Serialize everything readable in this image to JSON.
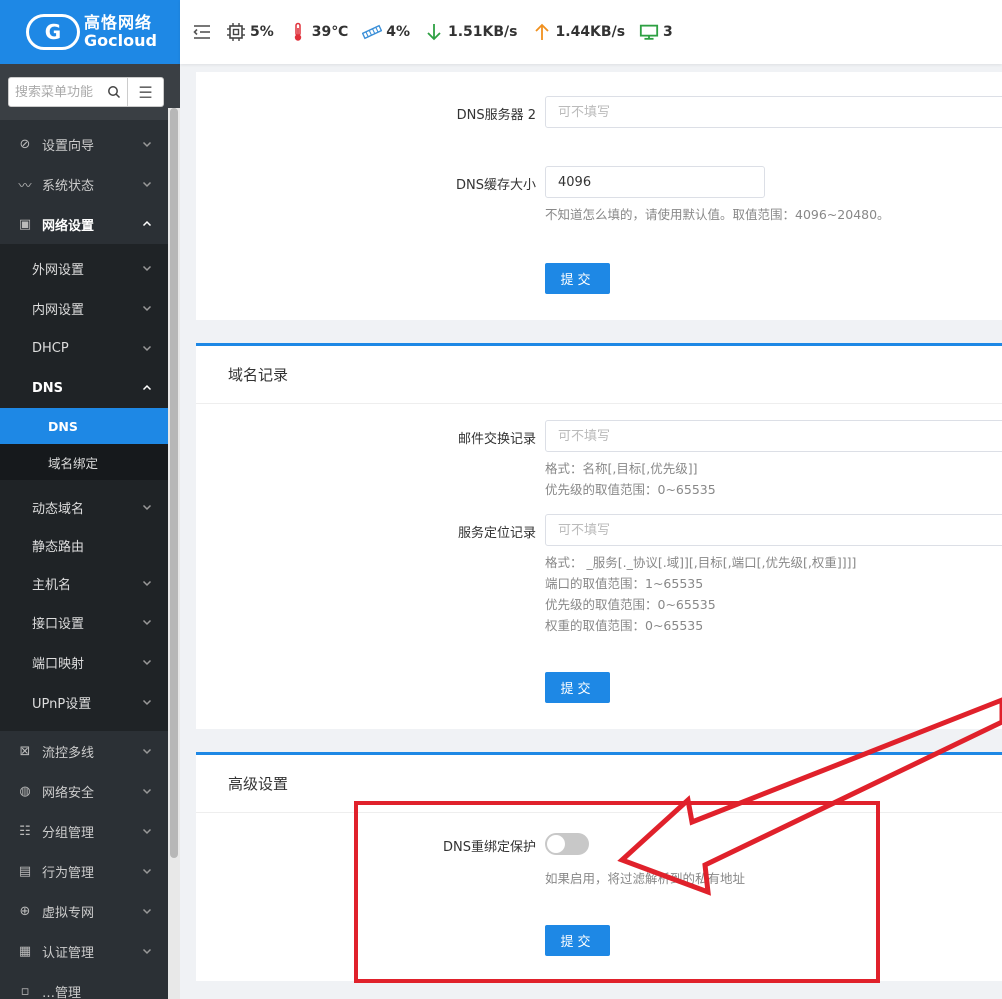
{
  "brand": {
    "cn": "高恪网络",
    "en": "Gocloud",
    "registered": "®"
  },
  "sidebar": {
    "search_placeholder": "搜索菜单功能",
    "items": [
      {
        "label": "设置向导"
      },
      {
        "label": "系统状态"
      },
      {
        "label": "网络设置"
      }
    ],
    "network_sub": [
      {
        "label": "外网设置"
      },
      {
        "label": "内网设置"
      },
      {
        "label": "DHCP"
      },
      {
        "label": "DNS"
      }
    ],
    "dns_sub": [
      {
        "label": "DNS"
      },
      {
        "label": "域名绑定"
      }
    ],
    "network_sub_after": [
      {
        "label": "动态域名"
      },
      {
        "label": "静态路由"
      },
      {
        "label": "主机名"
      },
      {
        "label": "接口设置"
      },
      {
        "label": "端口映射"
      },
      {
        "label": "UPnP设置"
      }
    ],
    "items_after": [
      {
        "label": "流控多线"
      },
      {
        "label": "网络安全"
      },
      {
        "label": "分组管理"
      },
      {
        "label": "行为管理"
      },
      {
        "label": "虚拟专网"
      },
      {
        "label": "认证管理"
      },
      {
        "label": "…管理"
      }
    ]
  },
  "topbar": {
    "cpu": "5%",
    "temp": "39℃",
    "memory": "4%",
    "download": "1.51KB/s",
    "upload": "1.44KB/s",
    "devices": "3"
  },
  "dns_form": {
    "dns2_label": "DNS服务器 2",
    "dns2_placeholder": "可不填写",
    "cache_label": "DNS缓存大小",
    "cache_value": "4096",
    "cache_hint": "不知道怎么填的，请使用默认值。取值范围：4096~20480。",
    "submit": "提交"
  },
  "records": {
    "title": "域名记录",
    "mx_label": "邮件交换记录",
    "mx_placeholder": "可不填写",
    "mx_hint1": "格式：名称[,目标[,优先级]]",
    "mx_hint2": "优先级的取值范围：0~65535",
    "srv_label": "服务定位记录",
    "srv_placeholder": "可不填写",
    "srv_hint1": "格式： _服务[._协议[.域]][,目标[,端口[,优先级[,权重]]]]",
    "srv_hint2": "端口的取值范围：1~65535",
    "srv_hint3": "优先级的取值范围：0~65535",
    "srv_hint4": "权重的取值范围：0~65535",
    "submit": "提交"
  },
  "advanced": {
    "title": "高级设置",
    "rebind_label": "DNS重绑定保护",
    "rebind_enabled": false,
    "rebind_hint": "如果启用，将过滤解析到的私有地址",
    "submit": "提交"
  },
  "colors": {
    "accent": "#1e88e5",
    "sidebar": "#2b3035",
    "annotation": "#e0212b"
  }
}
